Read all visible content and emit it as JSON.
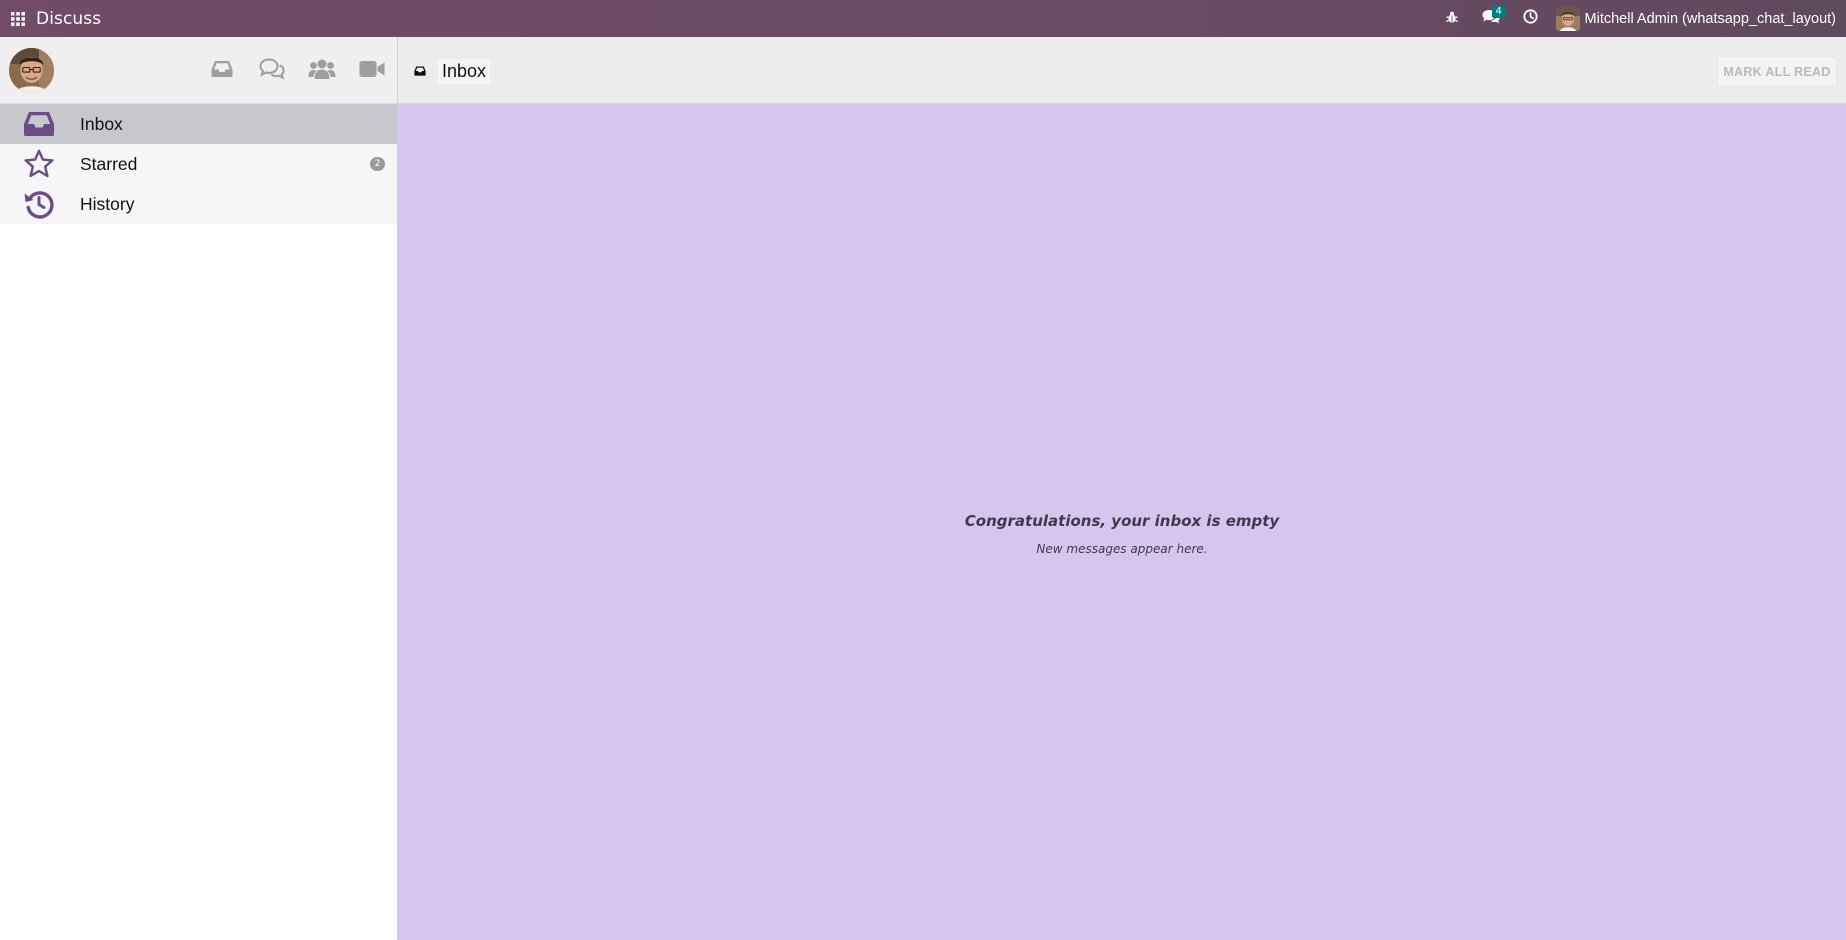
{
  "navbar": {
    "app_title": "Discuss",
    "chat_badge": "4",
    "user_name": "Mitchell Admin (whatsapp_chat_layout)",
    "icons": [
      "apps-grid-icon",
      "bug-icon",
      "chat-icon",
      "clock-icon"
    ]
  },
  "sidebar": {
    "tools": [
      "inbox-icon",
      "chat-bubbles-icon",
      "users-icon",
      "video-camera-icon"
    ],
    "items": [
      {
        "label": "Inbox",
        "icon": "inbox-icon",
        "active": true
      },
      {
        "label": "Starred",
        "icon": "star-icon",
        "count": "2"
      },
      {
        "label": "History",
        "icon": "history-icon"
      }
    ]
  },
  "main": {
    "thread_title": "Inbox",
    "mark_all_read": "MARK ALL READ",
    "empty_title": "Congratulations, your inbox is empty",
    "empty_subtitle": "New messages appear here."
  },
  "colors": {
    "navbar": "#714b67",
    "accent_icon": "#6a4d86",
    "content_background": "#d6c6ef",
    "active_item": "#c6c8ce",
    "badge": "#017e84"
  }
}
